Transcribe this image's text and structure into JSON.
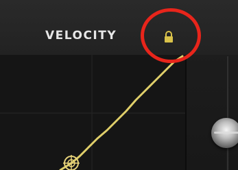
{
  "panel": {
    "title": "VELOCITY"
  },
  "icons": {
    "lock": "lock-icon",
    "curve_point": "crosshair-target-icon"
  },
  "colors": {
    "curve": "#e0cf6a",
    "lock": "#d9c24a",
    "highlight": "#e8251b"
  }
}
